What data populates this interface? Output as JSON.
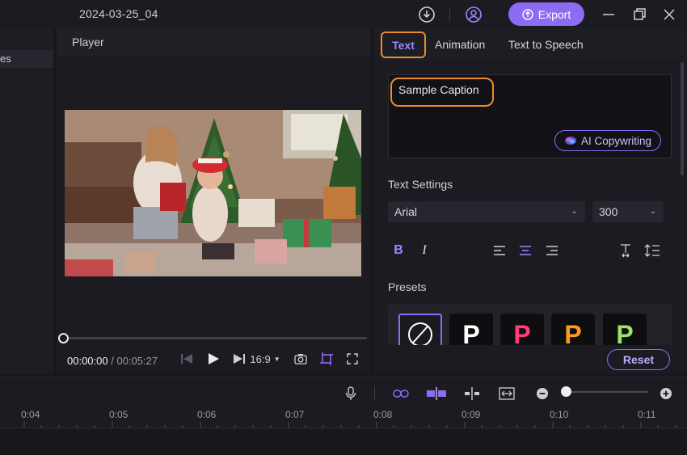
{
  "window": {
    "title": "2024-03-25_04",
    "export_label": "Export",
    "accent_color": "#8b6cf2",
    "highlight_color": "#f08a2c"
  },
  "left_panel": {
    "item_label": "es"
  },
  "player": {
    "title": "Player",
    "current_time": "00:00:00",
    "separator": "/",
    "total_time": "00:05:27",
    "progress": 0,
    "aspect_ratio": "16:9"
  },
  "panel": {
    "tabs": [
      {
        "label": "Text",
        "active": true
      },
      {
        "label": "Animation",
        "active": false
      },
      {
        "label": "Text to Speech",
        "active": false
      }
    ],
    "caption_text": "Sample Caption",
    "ai_button_label": "AI Copywriting",
    "text_settings_label": "Text Settings",
    "font_family_value": "Arial",
    "font_size_value": "300",
    "presets_label": "Presets",
    "presets": [
      {
        "name": "none",
        "letter": ""
      },
      {
        "name": "white",
        "letter": "P",
        "color": "#ffffff"
      },
      {
        "name": "pink",
        "letter": "P",
        "color": "#ff3d7a"
      },
      {
        "name": "orange",
        "letter": "P",
        "color": "#ff9a1f"
      },
      {
        "name": "green",
        "letter": "P",
        "color": "#9be564"
      }
    ],
    "reset_label": "Reset"
  },
  "timeline": {
    "zoom_level": 0.05,
    "ruler_ticks": [
      "0:04",
      "0:05",
      "0:06",
      "0:07",
      "0:08",
      "0:09",
      "0:10",
      "0:11"
    ]
  }
}
